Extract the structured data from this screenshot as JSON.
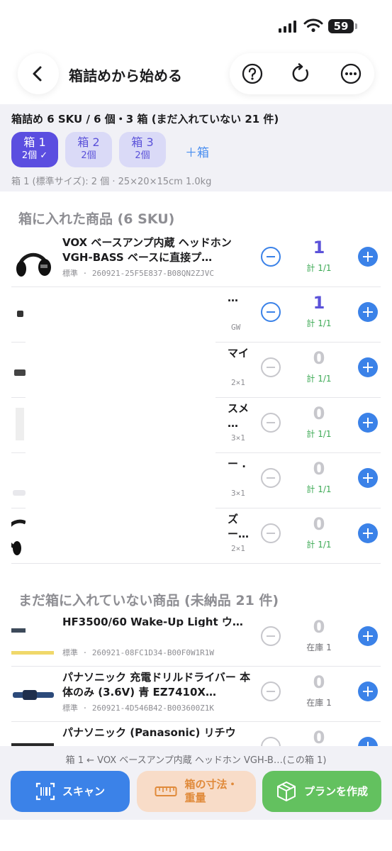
{
  "status_bar": {
    "battery": "59"
  },
  "nav": {
    "title": "箱詰めから始める"
  },
  "summary": {
    "title": "箱詰め 6 SKU / 6 個・3 箱 (まだ入れていない 21 件)",
    "boxes": [
      {
        "name": "箱 1",
        "count": "2個 ✓"
      },
      {
        "name": "箱 2",
        "count": "2個"
      },
      {
        "name": "箱 3",
        "count": "2個"
      }
    ],
    "add_box": "＋箱",
    "detail": "箱 1 (標準サイズ): 2 個 · 25×20×15cm 1.0kg"
  },
  "packed_section": {
    "header": "箱に入れた商品 (6 SKU)",
    "items": [
      {
        "name": "VOX ベースアンプ内蔵 ヘッドホン VGH-BASS ベースに直接プ…",
        "meta": "標準 · 260921-25F5E837-B08QN2ZJVC",
        "qty": "1",
        "note": "計 1/1"
      },
      {
        "name": "…",
        "meta": "GW",
        "qty": "1",
        "note": "計 1/1"
      },
      {
        "name": "マイ",
        "meta": "2×1",
        "qty": "0",
        "note": "計 1/1"
      },
      {
        "name": "スメ …",
        "meta": "3×1",
        "qty": "0",
        "note": "計 1/1"
      },
      {
        "name": "ー .",
        "meta": "3×1",
        "qty": "0",
        "note": "計 1/1"
      },
      {
        "name": "ズ ー…",
        "meta": "2×1",
        "qty": "0",
        "note": "計 1/1"
      }
    ]
  },
  "unpacked_section": {
    "header": "まだ箱に入れていない商品 (未納品 21 件)",
    "items": [
      {
        "name": "HF3500/60 Wake-Up Light ウ…",
        "meta": "標準 · 260921-08FC1D34-B00F0W1R1W",
        "qty": "0",
        "note": "在庫 1"
      },
      {
        "name": "パナソニック 充電ドリルドライバー 本体のみ (3.6V) 青 EZ7410X…",
        "meta": "標準 · 260921-4D546B42-B003600Z1K",
        "qty": "0",
        "note": "在庫 1"
      },
      {
        "name": "パナソニック (Panasonic) リチウ",
        "meta": "",
        "qty": "0",
        "note": ""
      }
    ]
  },
  "bottom": {
    "status": "箱 1 ← VOX ベースアンプ内蔵 ヘッドホン VGH-B…(この箱 1)",
    "scan": "スキャン",
    "dims_line1": "箱の寸法・",
    "dims_line2": "重量",
    "plan": "プランを作成"
  },
  "colors": {
    "accent_purple": "#5b4ee0",
    "accent_blue": "#3b82e8",
    "green": "#63c15f",
    "orange_bg": "#f8dcc8",
    "orange_text": "#e08a3a"
  },
  "icons": [
    "back-icon",
    "help-icon",
    "refresh-icon",
    "more-icon",
    "barcode-icon",
    "ruler-icon",
    "package-icon"
  ]
}
